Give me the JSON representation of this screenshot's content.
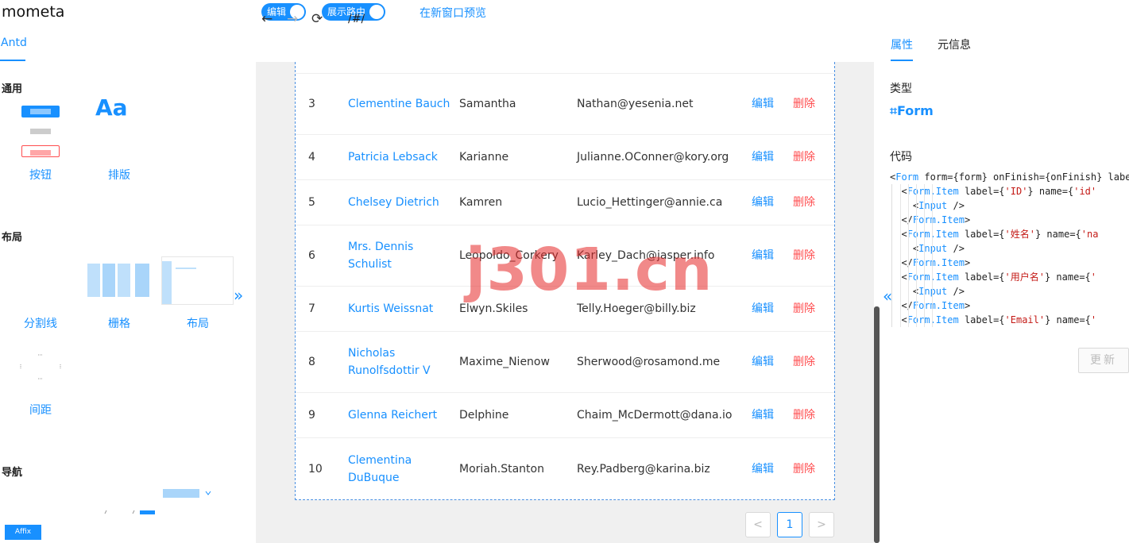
{
  "app": {
    "title": "mometa"
  },
  "toolbar": {
    "edit_toggle": "编辑",
    "route_toggle": "展示路由",
    "preview_link": "在新窗口预览"
  },
  "left": {
    "tab": "Antd",
    "sections": {
      "general": "通用",
      "layout": "布局",
      "navigation": "导航"
    },
    "components": {
      "button": "按钮",
      "typography": "排版",
      "typography_glyph": "Aa",
      "divider": "分割线",
      "grid": "栅格",
      "layout": "布局",
      "space": "间距"
    },
    "affix_label": "Affix",
    "collapse_icon": "»"
  },
  "browser": {
    "back": "←",
    "forward": "→",
    "refresh": "⟳",
    "path": "/#/"
  },
  "table": {
    "rows": [
      {
        "id": "3",
        "name": "Clementine Bauch",
        "username": "Samantha",
        "email": "Nathan@yesenia.net",
        "edit": "编辑",
        "delete": "删除"
      },
      {
        "id": "4",
        "name": "Patricia Lebsack",
        "username": "Karianne",
        "email": "Julianne.OConner@kory.org",
        "edit": "编辑",
        "delete": "删除"
      },
      {
        "id": "5",
        "name": "Chelsey Dietrich",
        "username": "Kamren",
        "email": "Lucio_Hettinger@annie.ca",
        "edit": "编辑",
        "delete": "删除"
      },
      {
        "id": "6",
        "name": "Mrs. Dennis Schulist",
        "username": "Leopoldo_Corkery",
        "email": "Karley_Dach@jasper.info",
        "edit": "编辑",
        "delete": "删除"
      },
      {
        "id": "7",
        "name": "Kurtis Weissnat",
        "username": "Elwyn.Skiles",
        "email": "Telly.Hoeger@billy.biz",
        "edit": "编辑",
        "delete": "删除"
      },
      {
        "id": "8",
        "name": "Nicholas Runolfsdottir V",
        "username": "Maxime_Nienow",
        "email": "Sherwood@rosamond.me",
        "edit": "编辑",
        "delete": "删除"
      },
      {
        "id": "9",
        "name": "Glenna Reichert",
        "username": "Delphine",
        "email": "Chaim_McDermott@dana.io",
        "edit": "编辑",
        "delete": "删除"
      },
      {
        "id": "10",
        "name": "Clementina DuBuque",
        "username": "Moriah.Stanton",
        "email": "Rey.Padberg@karina.biz",
        "edit": "编辑",
        "delete": "删除"
      }
    ]
  },
  "pagination": {
    "prev": "<",
    "current": "1",
    "next": ">"
  },
  "watermark": "j301.cn",
  "right": {
    "tabs": {
      "props": "属性",
      "meta": "元信息"
    },
    "type_label": "类型",
    "type_value": "⌗Form",
    "code_label": "代码",
    "code_lines": [
      "<Form form={form} onFinish={onFinish} labe",
      "  <Form.Item label={'ID'} name={'id'",
      "    <Input />",
      "  </Form.Item>",
      "  <Form.Item label={'姓名'} name={'na",
      "    <Input />",
      "  </Form.Item>",
      "  <Form.Item label={'用户名'} name={'",
      "    <Input />",
      "  </Form.Item>",
      "  <Form.Item label={'Email'} name={'"
    ],
    "update_button": "更新",
    "collapse_icon": "«"
  },
  "colors": {
    "accent": "#1890ff",
    "danger": "#ff4d4f",
    "canvas": "#f0f0f0"
  }
}
